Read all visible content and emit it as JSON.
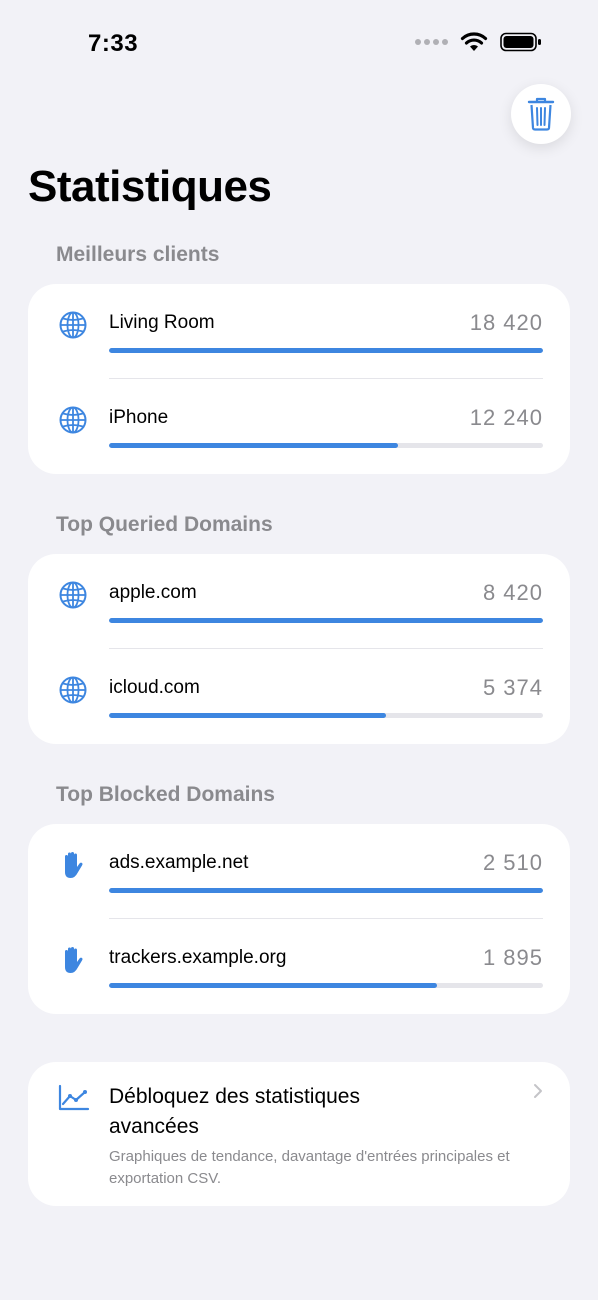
{
  "status_bar": {
    "time": "7:33"
  },
  "page": {
    "title": "Statistiques"
  },
  "colors": {
    "accent": "#3d86e0",
    "track": "#e5e5ea",
    "secondary_text": "#8a8a8e",
    "background": "#f2f2f7"
  },
  "sections": [
    {
      "header": "Meilleurs clients",
      "icon": "globe-icon",
      "items": [
        {
          "label": "Living Room",
          "count": "18 420",
          "value": 18420,
          "fraction": 1.0
        },
        {
          "label": "iPhone",
          "count": "12 240",
          "value": 12240,
          "fraction": 0.665
        }
      ]
    },
    {
      "header": "Top Queried Domains",
      "icon": "globe-icon",
      "items": [
        {
          "label": "apple.com",
          "count": "8 420",
          "value": 8420,
          "fraction": 1.0
        },
        {
          "label": "icloud.com",
          "count": "5 374",
          "value": 5374,
          "fraction": 0.638
        }
      ]
    },
    {
      "header": "Top Blocked Domains",
      "icon": "hand-raised-icon",
      "items": [
        {
          "label": "ads.example.net",
          "count": "2 510",
          "value": 2510,
          "fraction": 1.0
        },
        {
          "label": "trackers.example.org",
          "count": "1 895",
          "value": 1895,
          "fraction": 0.755
        }
      ]
    }
  ],
  "promo": {
    "icon": "line-chart-icon",
    "title": "Débloquez des statistiques avancées",
    "description": "Graphiques de tendance, davantage d'entrées principales et exportation CSV."
  }
}
